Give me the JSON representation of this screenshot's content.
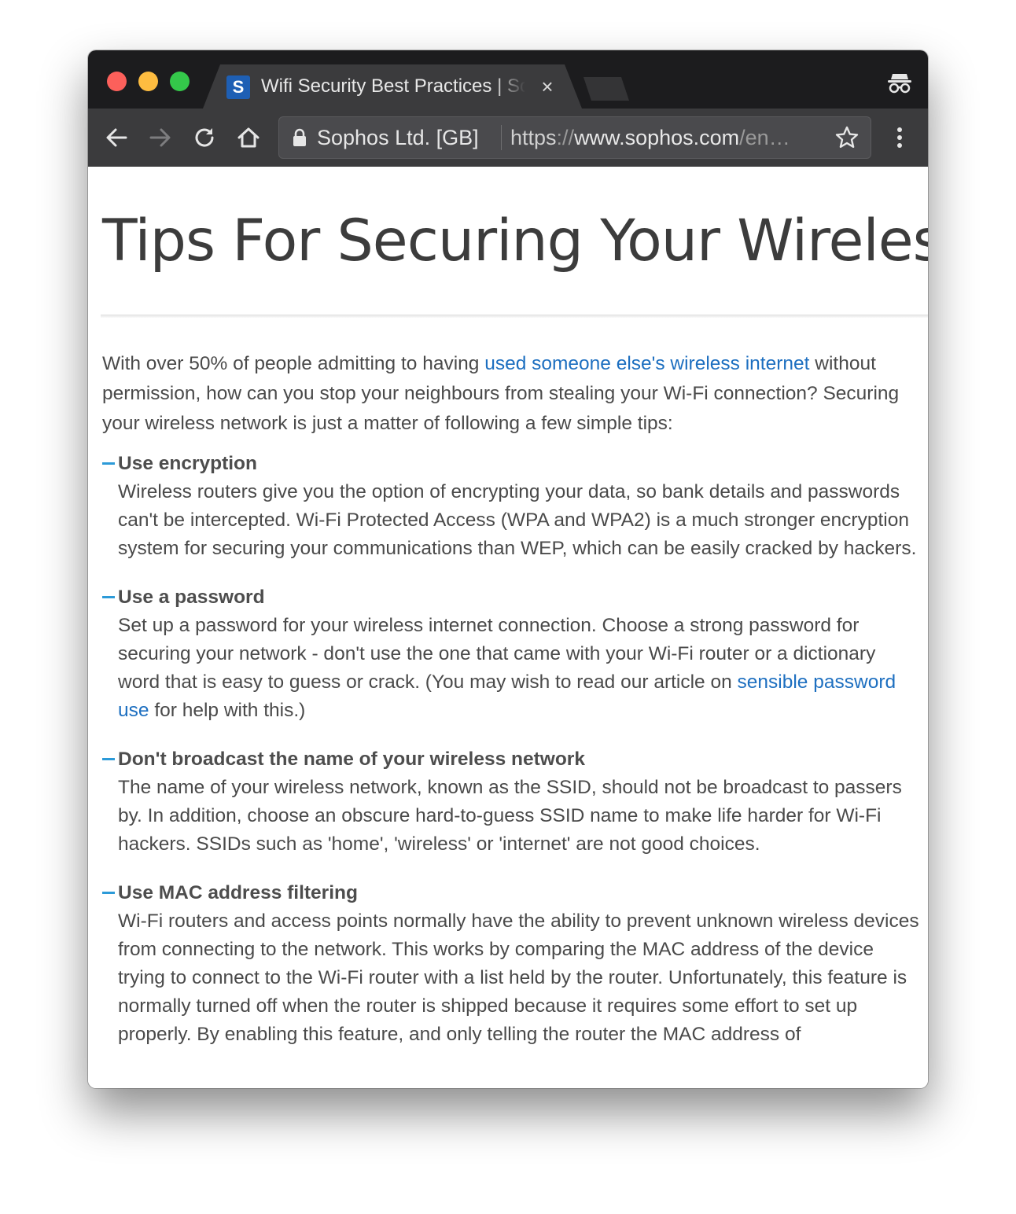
{
  "browser": {
    "tab": {
      "favicon_letter": "S",
      "title": "Wifi Security Best Practices | Sophos",
      "close_glyph": "×"
    },
    "address_bar": {
      "site_identity": "Sophos Ltd. [GB]",
      "url_scheme": "https",
      "url_slashes": "://",
      "url_host": "www.sophos.com",
      "url_path": "/en…"
    },
    "icons": [
      "back-icon",
      "forward-icon",
      "reload-icon",
      "home-icon",
      "lock-icon",
      "star-icon",
      "menu-icon",
      "incognito-icon"
    ]
  },
  "article": {
    "heading": "Tips For Securing Your Wireless",
    "intro": {
      "before_link": "With over 50% of people admitting to having ",
      "link_text": "used someone else's wireless internet",
      "after_link": " without permission, how can you stop your neighbours from stealing your Wi-Fi connection? Securing your wireless network is just a matter of following a few simple tips:"
    },
    "tips": [
      {
        "title": "Use encryption",
        "body": "Wireless routers give you the option of encrypting your data, so bank details and passwords can't be intercepted. Wi-Fi Protected Access (WPA and WPA2) is a much stronger encryption system for securing your communications than WEP, which can be easily cracked by hackers."
      },
      {
        "title": "Use a password",
        "body_before_link": "Set up a password for your wireless internet connection. Choose a strong password for securing your network - don't use the one that came with your Wi-Fi router or a dictionary word that is easy to guess or crack. (You may wish to read our article on ",
        "link_text": "sensible password use",
        "body_after_link": " for help with this.)"
      },
      {
        "title": "Don't broadcast the name of your wireless network",
        "body": "The name of your wireless network, known as the SSID, should not be broadcast to passers by. In addition, choose an obscure hard-to-guess SSID name to make life harder for Wi-Fi hackers. SSIDs such as 'home', 'wireless' or 'internet' are not good choices."
      },
      {
        "title": "Use MAC address filtering",
        "body": "Wi-Fi routers and access points normally have the ability to prevent unknown wireless devices from connecting to the network. This works by comparing the MAC address of the device trying to connect to the Wi-Fi router with a list held by the router. Unfortunately, this feature is normally turned off when the router is shipped because it requires some effort to set up properly. By enabling this feature, and only telling the router the MAC address of"
      }
    ]
  },
  "colors": {
    "link": "#1d6fc0",
    "tip_dash": "#2c9ad8",
    "favicon": "#1e5fb4",
    "traffic_close": "#fc605b",
    "traffic_minimize": "#fdbc40",
    "traffic_maximize": "#34c84a"
  }
}
